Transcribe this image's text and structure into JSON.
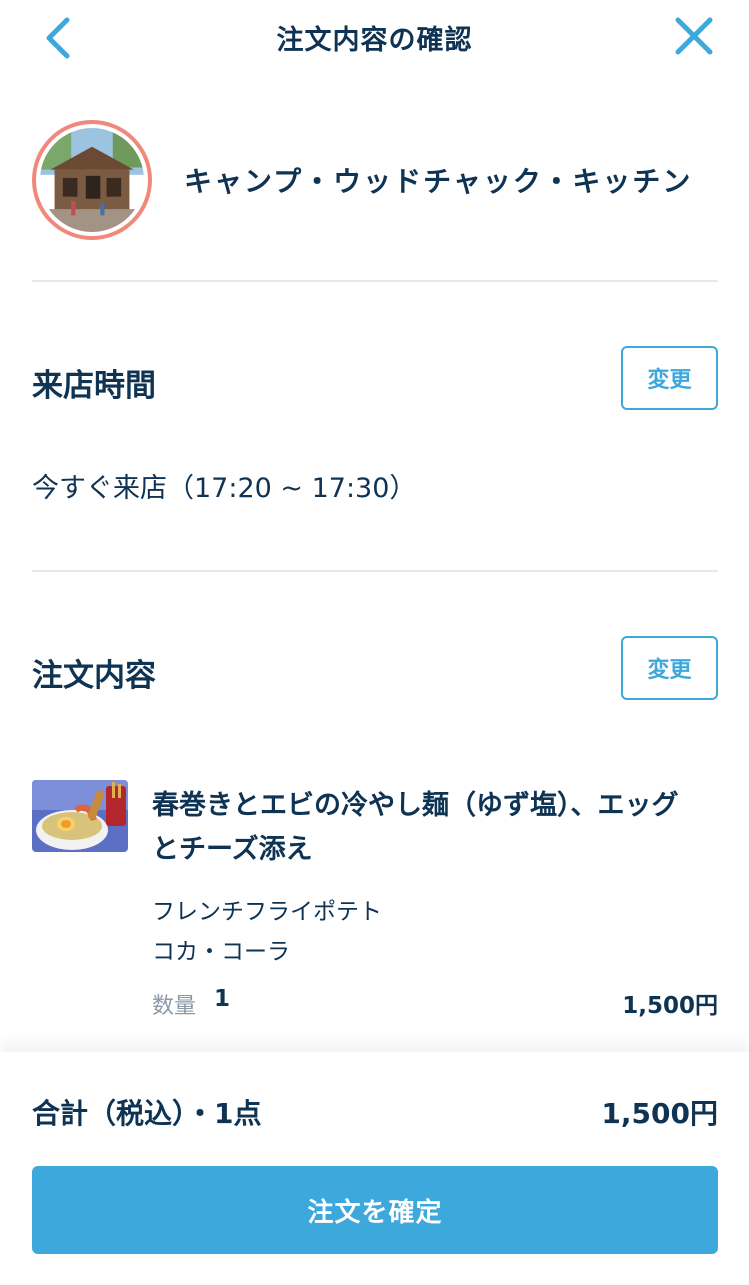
{
  "header": {
    "title": "注文内容の確認",
    "back_icon": "chevron-left-icon",
    "close_icon": "close-icon"
  },
  "store": {
    "name": "キャンプ・ウッドチャック・キッチン"
  },
  "visit": {
    "title": "来店時間",
    "change_label": "変更",
    "time_text": "今すぐ来店（17:20 ~ 17:30）"
  },
  "order": {
    "title": "注文内容",
    "change_label": "変更",
    "items": [
      {
        "name_line1": "春巻きとエビの冷やし麺（ゆず塩）、エッグ",
        "name_line2": "とチーズ添え",
        "options": [
          "フレンチフライポテト",
          "コカ・コーラ"
        ],
        "qty_label": "数量",
        "qty": "1",
        "price": "1,500円"
      }
    ]
  },
  "footer": {
    "total_label": "合計（税込）・1点",
    "total_price": "1,500円",
    "confirm_label": "注文を確定"
  },
  "colors": {
    "accent": "#3da8dc",
    "text": "#0f3353",
    "avatar_ring": "#f0887c",
    "muted": "#8a99a8"
  }
}
